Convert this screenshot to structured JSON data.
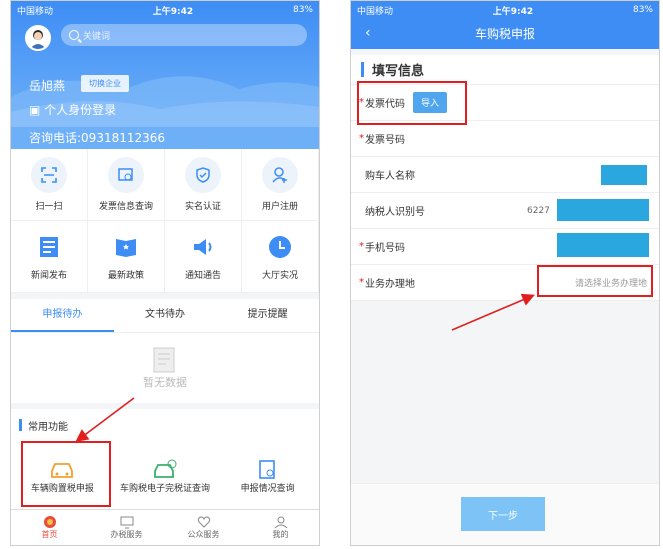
{
  "left": {
    "status": {
      "carrier": "中国移动",
      "time": "上午9:42",
      "battery": "83%"
    },
    "search_placeholder": "关键词",
    "user_name": "岳旭燕",
    "switch_label": "切换企业",
    "login_type": "个人身份登录",
    "hotline": "咨询电话:09318112366",
    "grid": [
      {
        "label": "扫一扫",
        "icon": "scan-icon"
      },
      {
        "label": "发票信息查询",
        "icon": "invoice-search-icon"
      },
      {
        "label": "实名认证",
        "icon": "shield-icon"
      },
      {
        "label": "用户注册",
        "icon": "user-add-icon"
      },
      {
        "label": "新闻发布",
        "icon": "news-icon"
      },
      {
        "label": "最新政策",
        "icon": "policy-icon"
      },
      {
        "label": "通知通告",
        "icon": "speaker-icon"
      },
      {
        "label": "大厅实况",
        "icon": "clock-icon"
      }
    ],
    "tabs": [
      "申报待办",
      "文书待办",
      "提示提醒"
    ],
    "empty_text": "暂无数据",
    "common_title": "常用功能",
    "functions": [
      {
        "label": "车辆购置税申报",
        "icon": "car-icon"
      },
      {
        "label": "车购税电子完税证查询",
        "icon": "car-certificate-icon"
      },
      {
        "label": "申报情况查询",
        "icon": "report-search-icon"
      }
    ],
    "tabbar": [
      "首页",
      "办税服务",
      "公众服务",
      "我的"
    ]
  },
  "right": {
    "status": {
      "carrier": "中国移动",
      "time": "上午9:42",
      "battery": "83%"
    },
    "title": "车购税申报",
    "section_title": "填写信息",
    "fields": {
      "invoice_code": {
        "label": "发票代码",
        "button": "导入"
      },
      "invoice_number": {
        "label": "发票号码"
      },
      "buyer_name": {
        "label": "购车人名称"
      },
      "taxpayer_id": {
        "label": "纳税人识别号",
        "value": "6227"
      },
      "phone": {
        "label": "手机号码"
      },
      "location": {
        "label": "业务办理地",
        "placeholder": "请选择业务办理地"
      }
    },
    "next_button": "下一步"
  },
  "colors": {
    "primary": "#3d8df5",
    "highlight": "#e02020",
    "redacted": "#2ba7df"
  }
}
